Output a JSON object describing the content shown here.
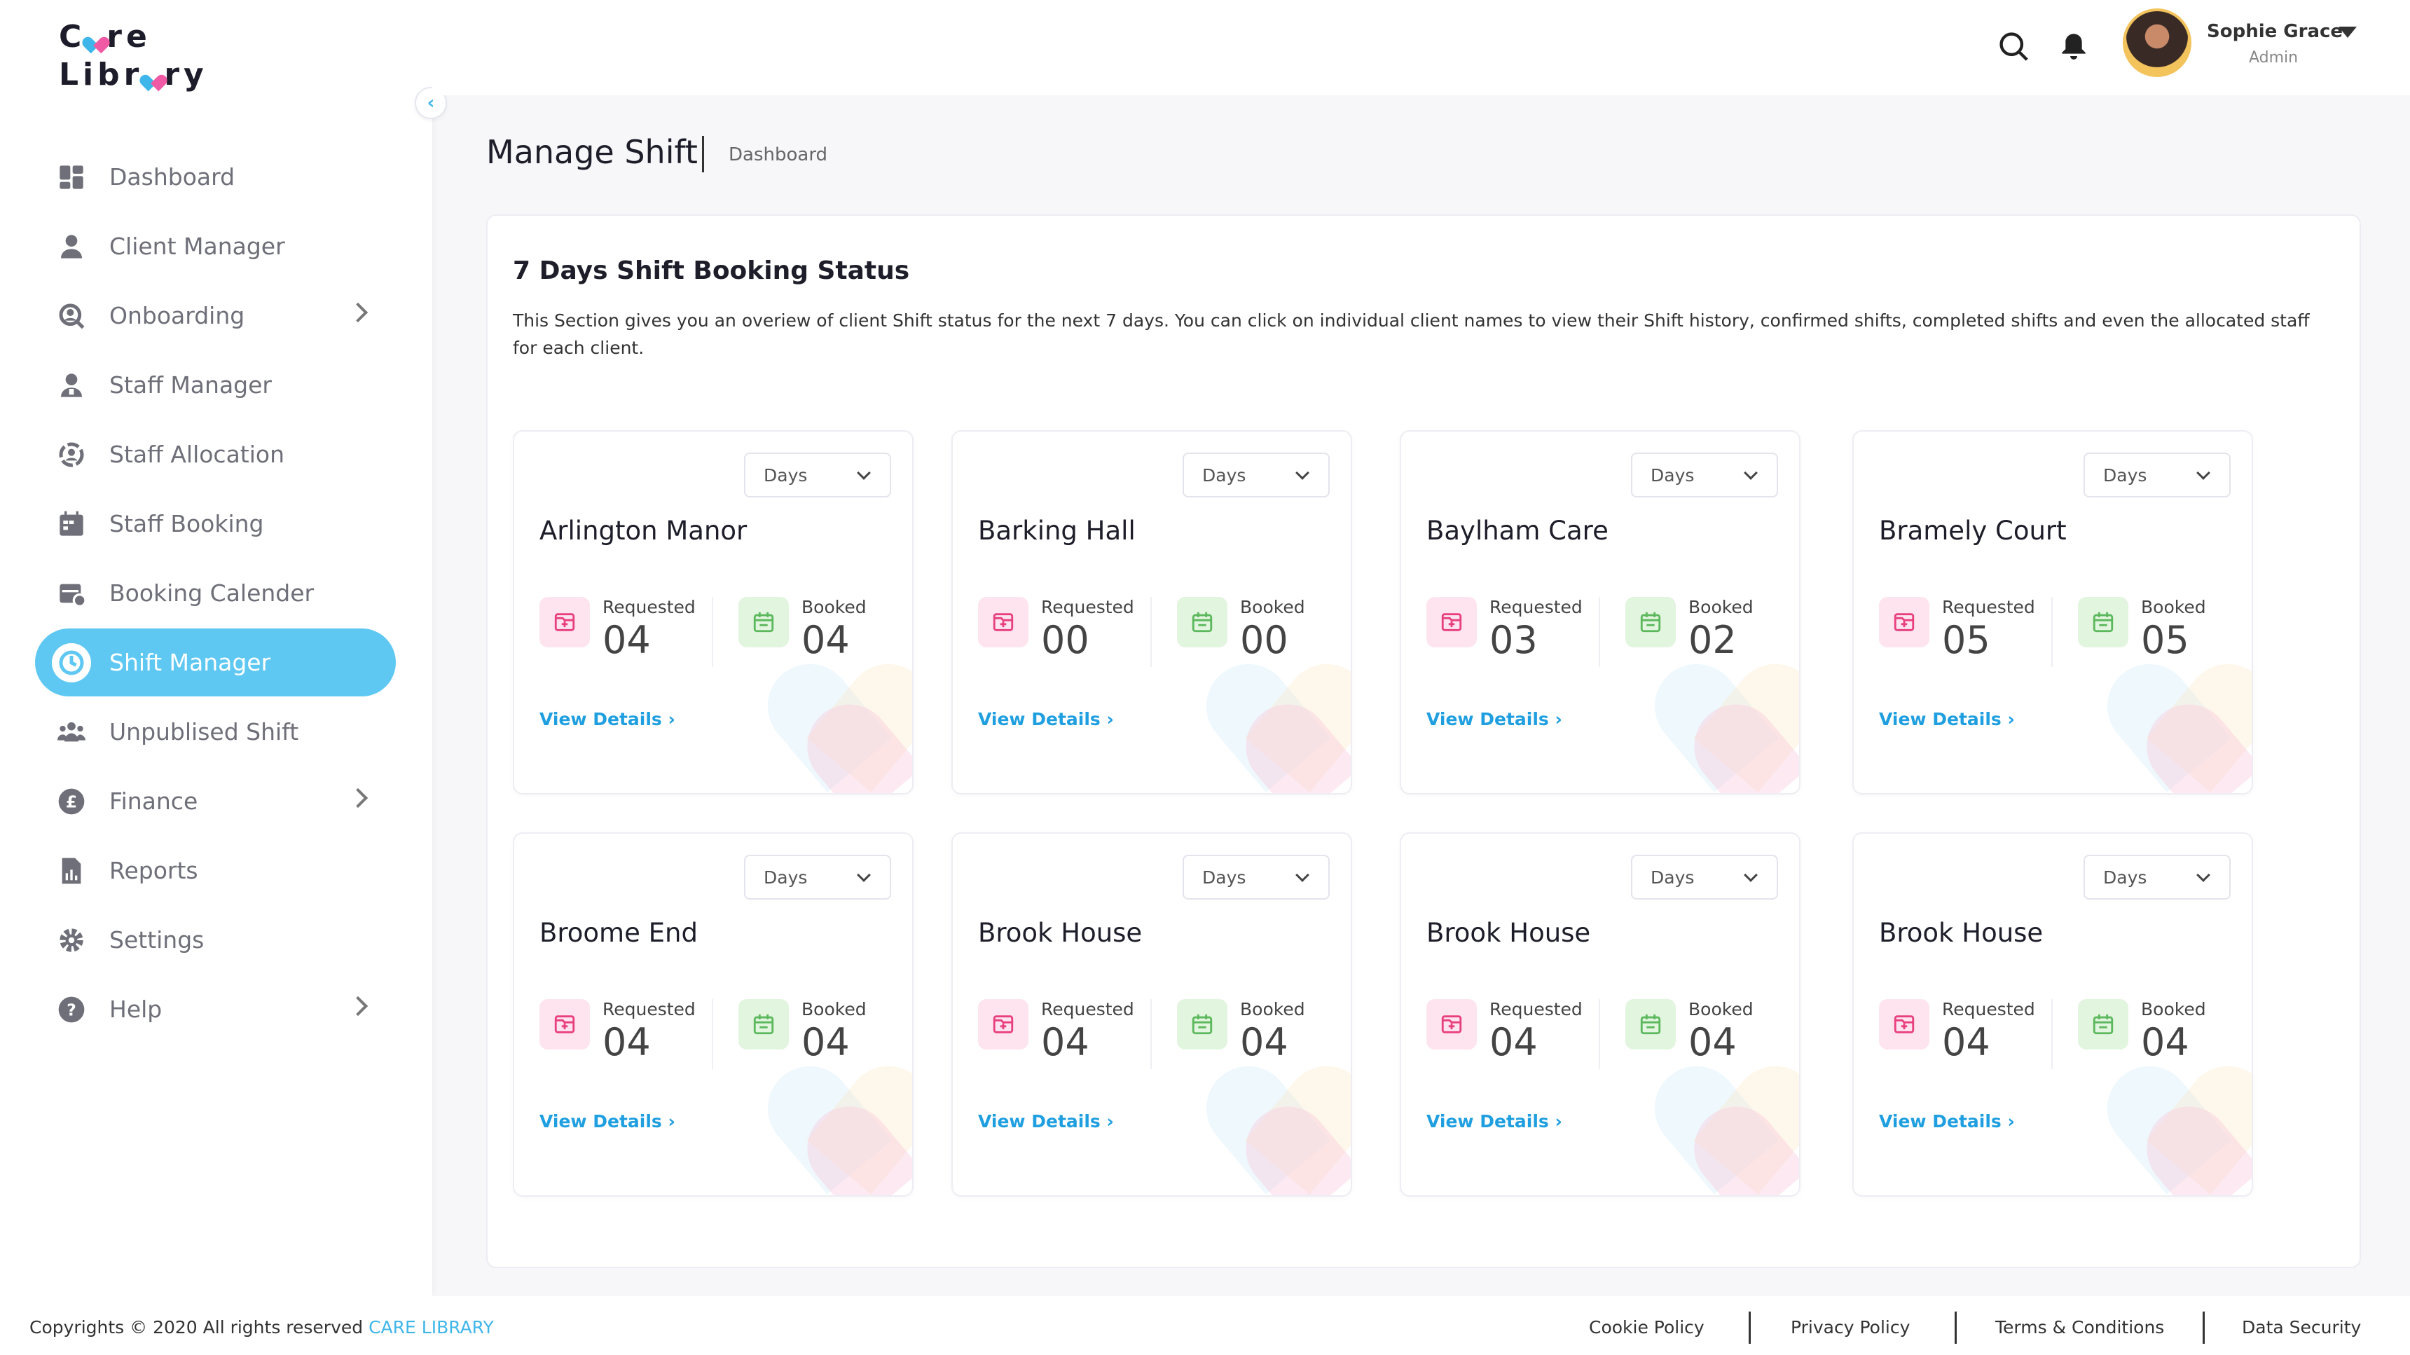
{
  "brand": {
    "line1_a": "C",
    "line1_b": "re",
    "line2_a": "Libr",
    "line2_b": "ry"
  },
  "sidebar": {
    "items": [
      {
        "label": "Dashboard",
        "icon": "dashboard-icon",
        "chevron": false
      },
      {
        "label": "Client Manager",
        "icon": "user-icon",
        "chevron": false
      },
      {
        "label": "Onboarding",
        "icon": "onboarding-icon",
        "chevron": true
      },
      {
        "label": "Staff Manager",
        "icon": "staff-icon",
        "chevron": false
      },
      {
        "label": "Staff Allocation",
        "icon": "allocation-icon",
        "chevron": false
      },
      {
        "label": "Staff Booking",
        "icon": "booking-icon",
        "chevron": false
      },
      {
        "label": "Booking Calender",
        "icon": "calendar-icon",
        "chevron": false
      },
      {
        "label": "Shift Manager",
        "icon": "clock-icon",
        "chevron": false,
        "active": true
      },
      {
        "label": "Unpublised Shift",
        "icon": "group-icon",
        "chevron": false
      },
      {
        "label": "Finance",
        "icon": "pound-icon",
        "chevron": true
      },
      {
        "label": "Reports",
        "icon": "report-icon",
        "chevron": false
      },
      {
        "label": "Settings",
        "icon": "gear-icon",
        "chevron": false
      },
      {
        "label": "Help",
        "icon": "help-icon",
        "chevron": true
      }
    ]
  },
  "header": {
    "user_name": "Sophie Grace",
    "user_role": "Admin"
  },
  "page": {
    "title": "Manage Shift",
    "breadcrumb": "Dashboard"
  },
  "panel": {
    "title": "7 Days Shift Booking Status",
    "description": "This Section gives you an overiew of client Shift status for the next 7 days. You can click on individual client names to view their Shift history, confirmed shifts, completed shifts and even the allocated staff for each client."
  },
  "cards": [
    {
      "name": "Arlington Manor",
      "select": "Days",
      "requested_label": "Requested",
      "requested": "04",
      "booked_label": "Booked",
      "booked": "04",
      "link": "View Details"
    },
    {
      "name": "Barking Hall",
      "select": "Days",
      "requested_label": "Requested",
      "requested": "00",
      "booked_label": "Booked",
      "booked": "00",
      "link": "View Details"
    },
    {
      "name": "Baylham Care",
      "select": "Days",
      "requested_label": "Requested",
      "requested": "03",
      "booked_label": "Booked",
      "booked": "02",
      "link": "View Details"
    },
    {
      "name": "Bramely Court",
      "select": "Days",
      "requested_label": "Requested",
      "requested": "05",
      "booked_label": "Booked",
      "booked": "05",
      "link": "View Details"
    },
    {
      "name": "Broome End",
      "select": "Days",
      "requested_label": "Requested",
      "requested": "04",
      "booked_label": "Booked",
      "booked": "04",
      "link": "View Details"
    },
    {
      "name": "Brook House",
      "select": "Days",
      "requested_label": "Requested",
      "requested": "04",
      "booked_label": "Booked",
      "booked": "04",
      "link": "View Details"
    },
    {
      "name": "Brook House",
      "select": "Days",
      "requested_label": "Requested",
      "requested": "04",
      "booked_label": "Booked",
      "booked": "04",
      "link": "View Details"
    },
    {
      "name": "Brook House",
      "select": "Days",
      "requested_label": "Requested",
      "requested": "04",
      "booked_label": "Booked",
      "booked": "04",
      "link": "View Details"
    }
  ],
  "footer": {
    "copyright": "Copyrights © 2020  All rights reserved",
    "brand": "CARE LIBRARY",
    "links": [
      "Cookie Policy",
      "Privacy Policy",
      "Terms & Conditions",
      "Data Security"
    ]
  },
  "colors": {
    "accent": "#5ec8f3",
    "link": "#1f9fe0",
    "requested_bg": "#fde4ee",
    "requested_icon": "#e8407f",
    "booked_bg": "#e2f5df",
    "booked_icon": "#5cb85c"
  }
}
